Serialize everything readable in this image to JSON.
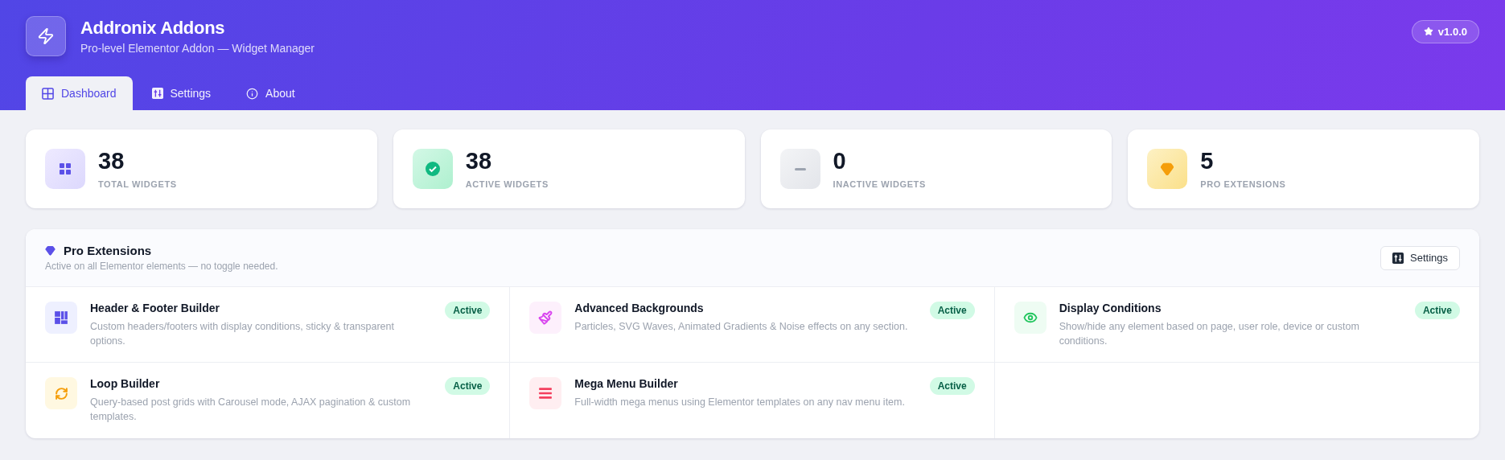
{
  "header": {
    "title": "Addronix Addons",
    "subtitle": "Pro-level Elementor Addon — Widget Manager",
    "version": "v1.0.0"
  },
  "tabs": [
    {
      "label": "Dashboard",
      "kind": "grid",
      "selected": true
    },
    {
      "label": "Settings",
      "kind": "sliders",
      "selected": false
    },
    {
      "label": "About",
      "kind": "info",
      "selected": false
    }
  ],
  "stats": [
    {
      "value": "38",
      "label": "TOTAL WIDGETS",
      "kind": "grid"
    },
    {
      "value": "38",
      "label": "ACTIVE WIDGETS",
      "kind": "check"
    },
    {
      "value": "0",
      "label": "INACTIVE WIDGETS",
      "kind": "minus"
    },
    {
      "value": "5",
      "label": "PRO EXTENSIONS",
      "kind": "gem"
    }
  ],
  "pro_extensions": {
    "title": "Pro Extensions",
    "subtitle": "Active on all Elementor elements — no toggle needed.",
    "button": "Settings",
    "items": [
      {
        "title": "Header & Footer Builder",
        "description": "Custom headers/footers with display conditions, sticky & transparent options.",
        "kind": "layout",
        "badge": "Active"
      },
      {
        "title": "Advanced Backgrounds",
        "description": "Particles, SVG Waves, Animated Gradients & Noise effects on any section.",
        "kind": "brush",
        "badge": "Active"
      },
      {
        "title": "Display Conditions",
        "description": "Show/hide any element based on page, user role, device or custom conditions.",
        "kind": "eye",
        "badge": "Active"
      },
      {
        "title": "Loop Builder",
        "description": "Query-based post grids with Carousel mode, AJAX pagination & custom templates.",
        "kind": "loop",
        "badge": "Active"
      },
      {
        "title": "Mega Menu Builder",
        "description": "Full-width mega menus using Elementor templates on any nav menu item.",
        "kind": "menu",
        "badge": "Active"
      }
    ]
  }
}
